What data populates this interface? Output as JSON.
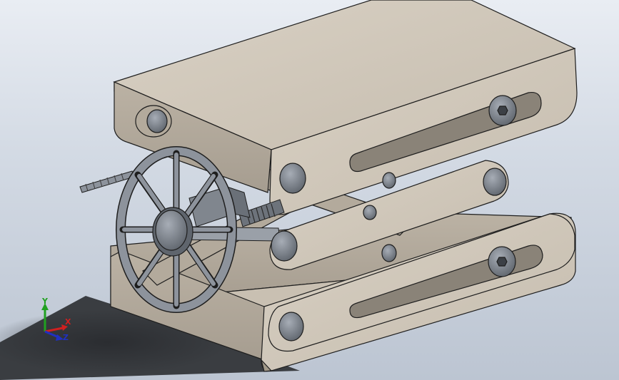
{
  "viewport": {
    "background_top": "#e9edf3",
    "background_bottom": "#bcc5d2",
    "part_color": "#cfc6b8",
    "part_edge_color": "#1e1e1e",
    "hardware_color": "#8d939c"
  },
  "triad": {
    "x_label": "X",
    "y_label": "Y",
    "z_label": "Z",
    "x_color": "#d02020",
    "y_color": "#20a020",
    "z_color": "#2030c0"
  }
}
